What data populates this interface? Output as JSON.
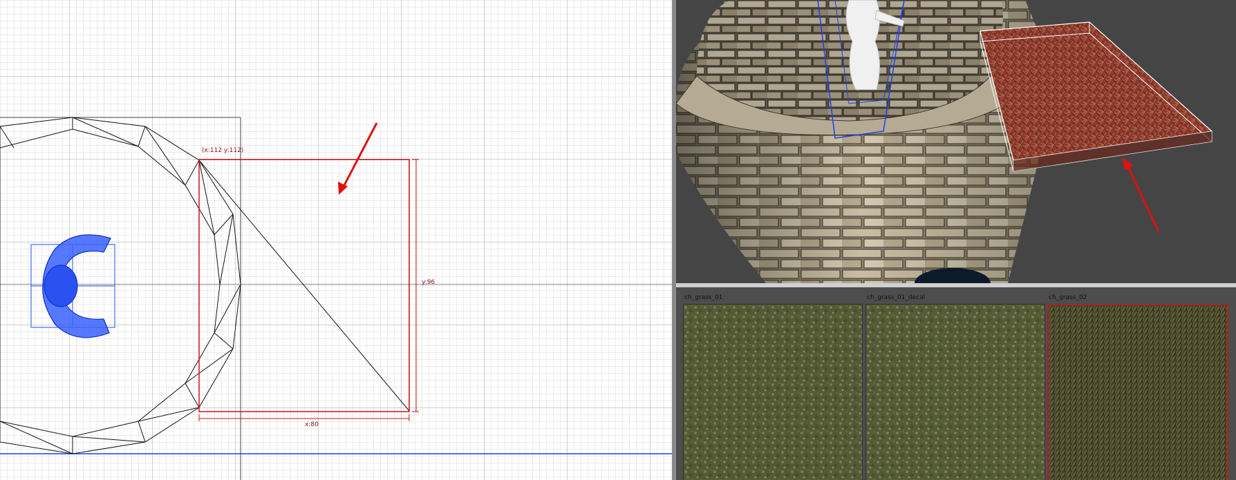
{
  "grid_view": {
    "corner_label": "(x:112  y:112)",
    "width_label": "x:80",
    "height_label": "y:96"
  },
  "texture_browser": {
    "tiles": [
      {
        "name": "ch_grass_01",
        "selected": false
      },
      {
        "name": "ch_grass_01_decal",
        "selected": false
      },
      {
        "name": "ch_grass_02",
        "selected": true
      }
    ]
  },
  "colors": {
    "selection": "#d01010",
    "annotation_arrow": "#e01010",
    "entity_wireframe": "#1a4dff",
    "grid_minor": "#d6d6d6",
    "grid_major": "#9a9a9a"
  }
}
